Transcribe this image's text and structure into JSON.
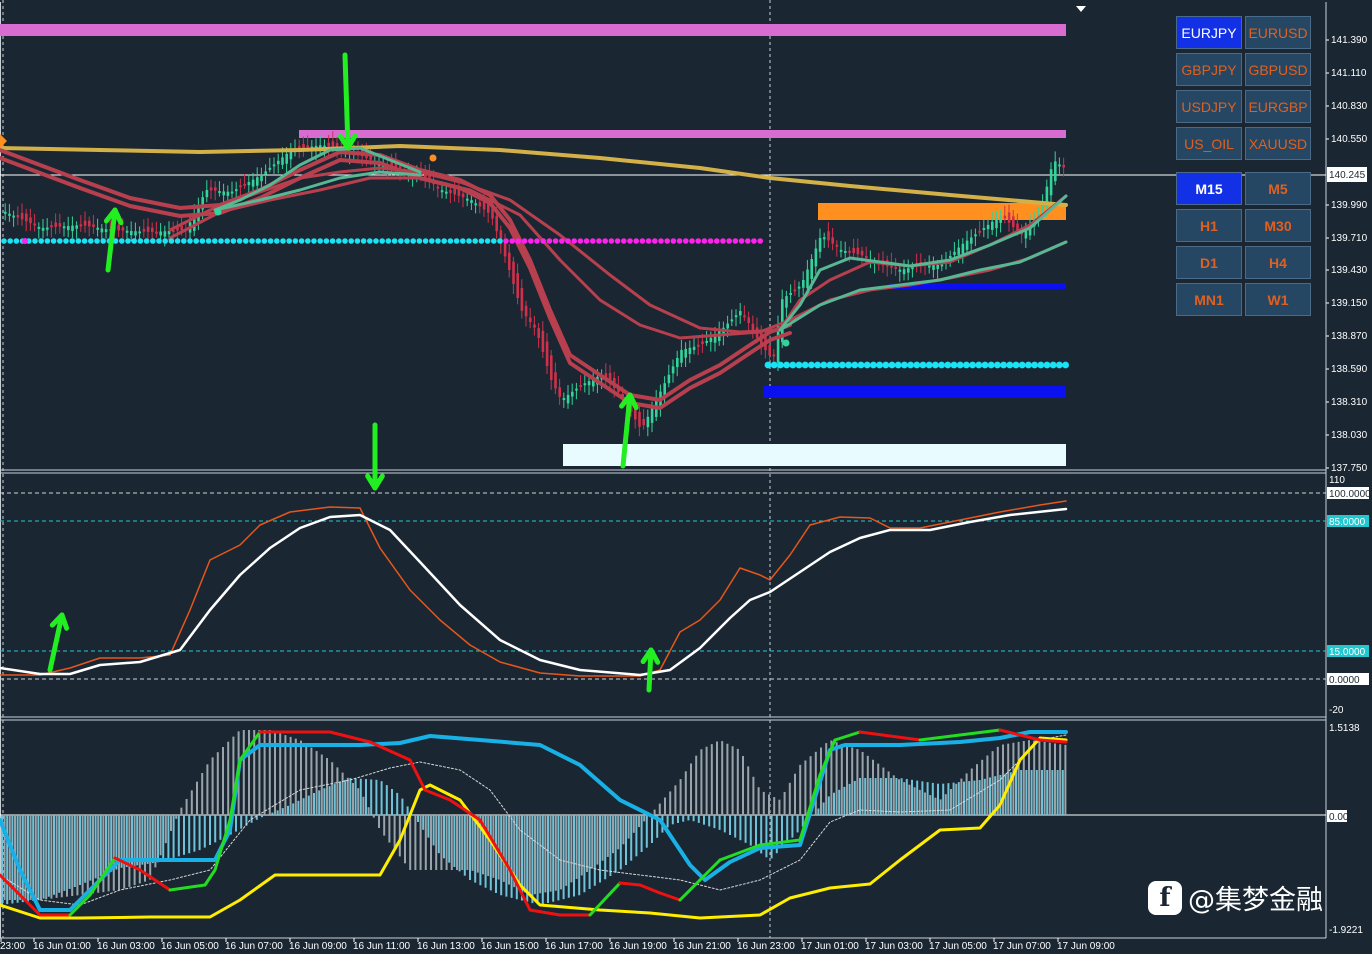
{
  "colors": {
    "background": "#1a2733",
    "bull_candle": "#34d399",
    "bear_candle": "#d0304a",
    "slow_ma": "#d4b048",
    "fast_ma": "#b8404e",
    "teal_ma": "#58b894",
    "cyan_dots": "#19e3f5",
    "magenta_dots": "#ff22ee",
    "stoch_main": "#ffffff",
    "stoch_signal": "#e8561a",
    "arrow": "#22ee22",
    "band_pink": "#d86cd0",
    "band_orange": "#ff9020",
    "band_blue": "#0a10f0",
    "band_white": "#e8fbff",
    "macd_cyan": "#19b0e6",
    "macd_yellow": "#ffee00",
    "hist_cyan": "#6fc3d8",
    "hist_gray": "#9aa3aa"
  },
  "price_axis": {
    "labels": [
      "141.390",
      "141.110",
      "140.830",
      "140.550",
      "140.245",
      "139.990",
      "139.710",
      "139.430",
      "139.150",
      "138.870",
      "138.590",
      "138.310",
      "138.030",
      "137.750"
    ],
    "current_price": "140.245"
  },
  "stoch_axis": {
    "labels": [
      "110",
      "100.0000",
      "85.0000",
      "15.0000",
      "0.0000",
      "-20"
    ]
  },
  "macd_axis": {
    "labels": [
      "1.5138",
      "0.00",
      "-1.9221"
    ]
  },
  "time_axis": {
    "labels": [
      "23:00",
      "16 Jun 01:00",
      "16 Jun 03:00",
      "16 Jun 05:00",
      "16 Jun 07:00",
      "16 Jun 09:00",
      "16 Jun 11:00",
      "16 Jun 13:00",
      "16 Jun 15:00",
      "16 Jun 17:00",
      "16 Jun 19:00",
      "16 Jun 21:00",
      "16 Jun 23:00",
      "17 Jun 01:00",
      "17 Jun 03:00",
      "17 Jun 05:00",
      "17 Jun 07:00",
      "17 Jun 09:00"
    ]
  },
  "symbol_buttons": [
    "EURJPY",
    "EURUSD",
    "GBPJPY",
    "GBPUSD",
    "USDJPY",
    "EURGBP",
    "US_OIL",
    "XAUUSD"
  ],
  "active_symbol": "EURJPY",
  "timeframe_buttons": [
    "M15",
    "M5",
    "H1",
    "M30",
    "D1",
    "H4",
    "MN1",
    "W1"
  ],
  "active_timeframe": "M15",
  "watermark": {
    "icon": "facebook-f-icon",
    "glyph": "f",
    "text": "@集梦金融"
  }
}
